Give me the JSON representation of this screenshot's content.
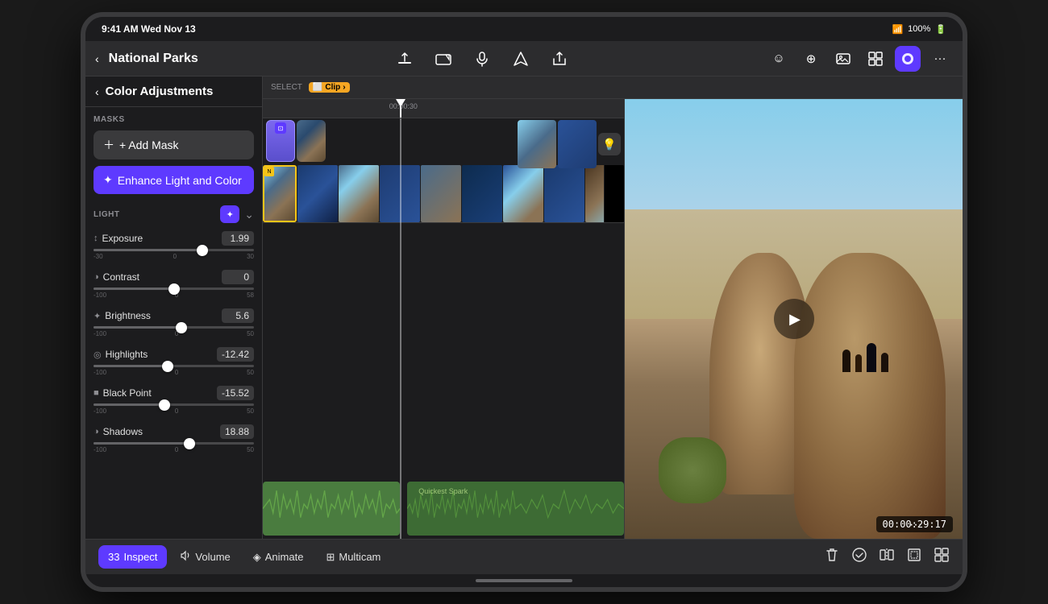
{
  "device": {
    "status_bar": {
      "time": "9:41 AM",
      "date": "Wed Nov 13",
      "battery": "100%",
      "wifi": true
    }
  },
  "toolbar": {
    "back_label": "‹",
    "project_title": "National Parks",
    "icons": {
      "upload": "↑",
      "camera": "⬜",
      "mic": "🎤",
      "location": "◎",
      "share": "↑",
      "emoji": "☺",
      "plus_circle": "⊕",
      "photo": "🖼",
      "multicam": "⊡",
      "color_active": "◉",
      "more": "···"
    }
  },
  "left_panel": {
    "back_label": "‹",
    "title": "Color Adjustments",
    "masks_label": "MASKS",
    "add_mask_label": "+ Add Mask",
    "enhance_btn_label": "Enhance Light and Color",
    "light_label": "LIGHT",
    "adjustments": [
      {
        "id": "exposure",
        "icon": "↕",
        "name": "Exposure",
        "value": "1.99",
        "thumb_pct": 68,
        "min": "-30",
        "max": "30"
      },
      {
        "id": "contrast",
        "icon": "◑",
        "name": "Contrast",
        "value": "0",
        "thumb_pct": 50,
        "min": "-100",
        "max": "58"
      },
      {
        "id": "brightness",
        "icon": "✦",
        "name": "Brightness",
        "value": "5.6",
        "thumb_pct": 55,
        "min": "-100",
        "max": "50"
      },
      {
        "id": "highlights",
        "icon": "◎",
        "name": "Highlights",
        "value": "-12.42",
        "thumb_pct": 46,
        "min": "-100",
        "max": "50"
      },
      {
        "id": "black_point",
        "icon": "■",
        "name": "Black Point",
        "value": "-15.52",
        "thumb_pct": 44,
        "min": "-100",
        "max": "50"
      },
      {
        "id": "shadows",
        "icon": "◑",
        "name": "Shadows",
        "value": "18.88",
        "thumb_pct": 60,
        "min": "-100",
        "max": "50"
      }
    ]
  },
  "select_bar": {
    "label": "Select",
    "clip_label": "Clip",
    "clip_icon": "C"
  },
  "preview": {
    "timecode": "00:00:29:17",
    "play_icon": "▶"
  },
  "timeline": {
    "time_labels": [
      "00:00:30"
    ],
    "audio_track_name": "Quickest Spark"
  },
  "bottom_bar": {
    "tabs": [
      {
        "id": "inspect",
        "icon": "33",
        "label": "Inspect",
        "active": true
      },
      {
        "id": "volume",
        "icon": "♪",
        "label": "Volume",
        "active": false
      },
      {
        "id": "animate",
        "icon": "◈",
        "label": "Animate",
        "active": false
      },
      {
        "id": "multicam",
        "icon": "⊞",
        "label": "Multicam",
        "active": false
      }
    ],
    "actions": {
      "delete": "🗑",
      "checkmark": "✓",
      "split": "⊢",
      "crop": "⊡",
      "grid": "⊞"
    }
  },
  "colors": {
    "accent_purple": "#5e3aff",
    "clip_yellow": "#f5c518",
    "audio_green": "#4a7c3f",
    "audio_label_green": "#6ab04c",
    "text_primary": "#ffffff",
    "text_secondary": "#8e8e93",
    "bg_panel": "#1c1c1e",
    "bg_toolbar": "#2c2c2e"
  }
}
